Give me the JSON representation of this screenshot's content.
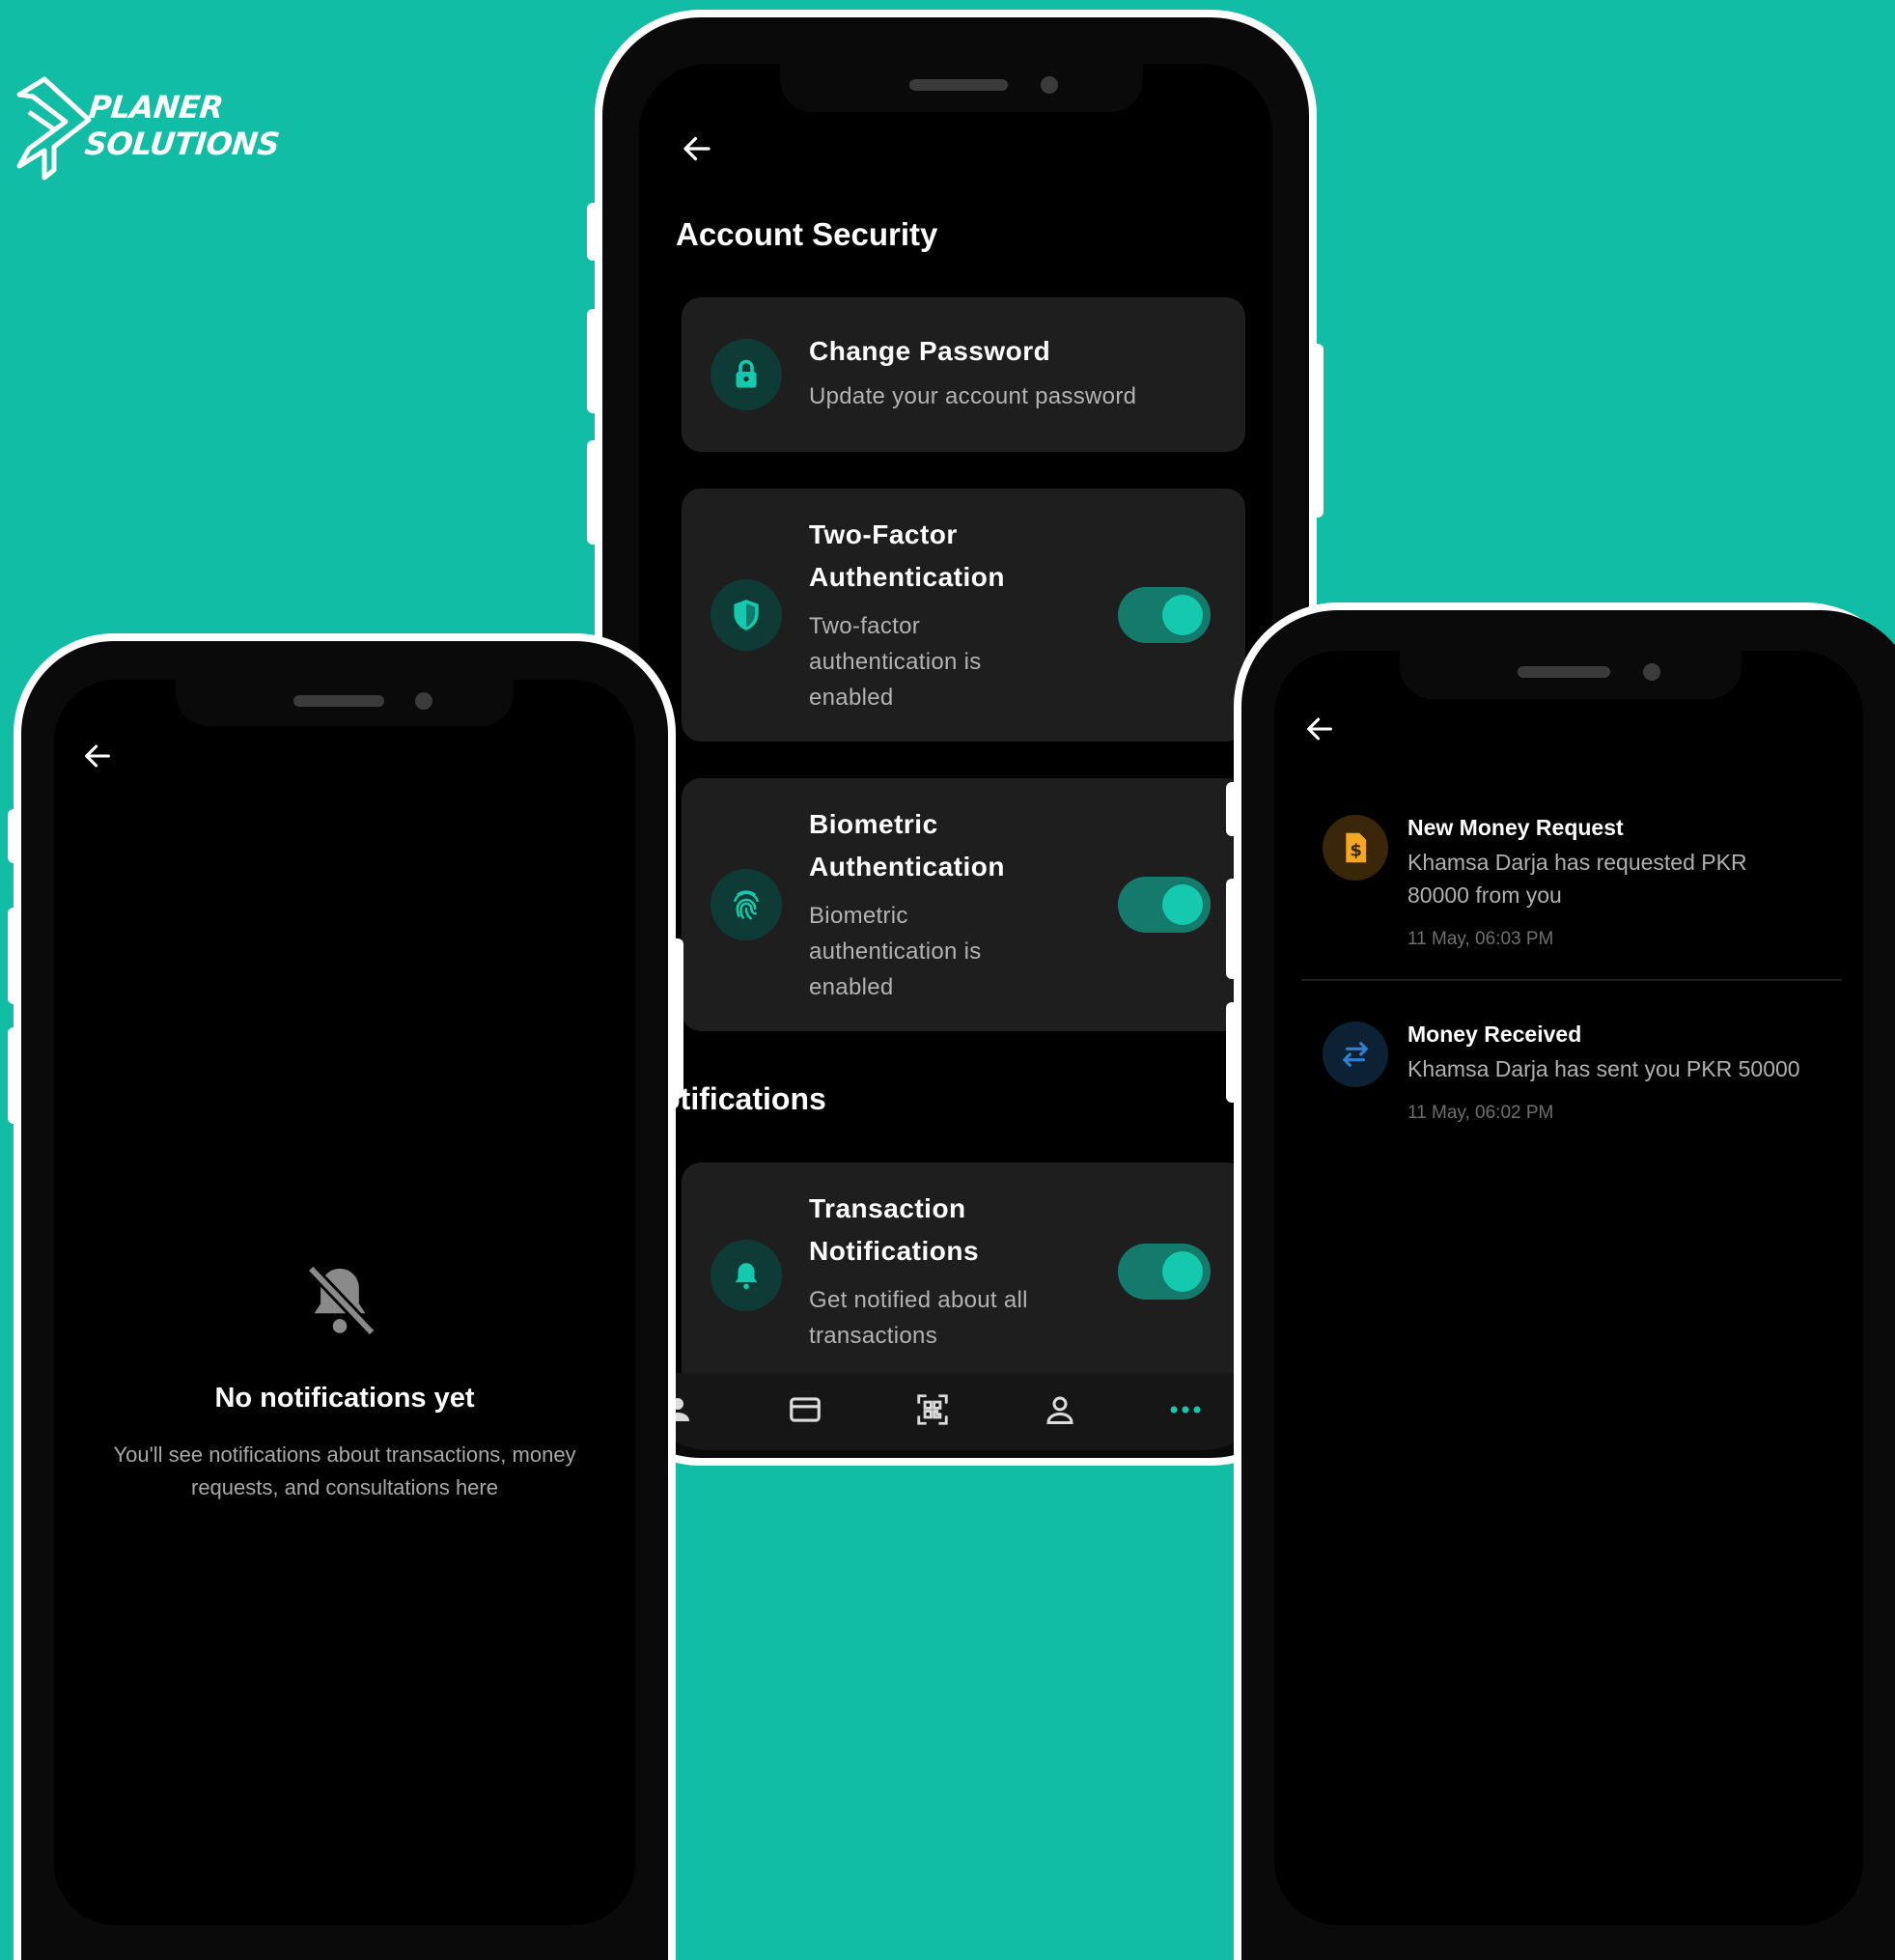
{
  "brand": {
    "line1": "PLANER",
    "line2": "SOLUTIONS",
    "icon": "planer-logo-mark"
  },
  "colors": {
    "background": "#12bda6",
    "accent": "#15c9ae",
    "toggle_track": "#147a6b",
    "card": "#1e1e1e",
    "money_request": "#f5a623",
    "money_received": "#2f7fd1"
  },
  "security_screen": {
    "back_icon": "back-arrow-icon",
    "account_section_title": "Account Security",
    "items": [
      {
        "title": "Change Password",
        "description": "Update your account password",
        "icon": "lock-icon"
      },
      {
        "title": "Two-Factor Authentication",
        "description": "Two-factor authentication is enabled",
        "icon": "shield-icon",
        "enabled": true
      },
      {
        "title": "Biometric Authentication",
        "description": "Biometric authentication is enabled",
        "icon": "fingerprint-icon",
        "enabled": true
      }
    ],
    "notifications_section_title": "Notifications",
    "notification_items": [
      {
        "title": "Transaction Notifications",
        "description": "Get notified about all transactions",
        "icon": "bell-icon",
        "enabled": true
      }
    ],
    "bottom_nav": [
      {
        "icon": "person-icon"
      },
      {
        "icon": "card-icon"
      },
      {
        "icon": "qr-code-icon"
      },
      {
        "icon": "profile-icon"
      },
      {
        "icon": "more-icon",
        "active": true
      }
    ]
  },
  "empty_screen": {
    "back_icon": "back-arrow-icon",
    "icon": "bell-off-icon",
    "title": "No notifications yet",
    "description": "You'll see notifications about transactions, money requests, and consultations here"
  },
  "notifications_screen": {
    "back_icon": "back-arrow-icon",
    "items": [
      {
        "title": "New Money Request",
        "description": "Khamsa Darja has requested PKR 80000 from you",
        "time": "11 May, 06:03 PM",
        "icon": "dollar-doc-icon"
      },
      {
        "title": "Money Received",
        "description": "Khamsa Darja has sent you PKR 50000",
        "time": "11 May, 06:02 PM",
        "icon": "transfer-arrows-icon"
      }
    ]
  }
}
